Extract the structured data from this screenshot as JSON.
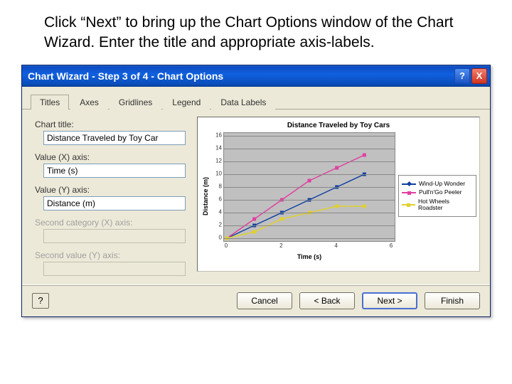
{
  "instruction": "Click “Next” to bring up the Chart Options window of the Chart Wizard.  Enter the title and appropriate axis-labels.",
  "window": {
    "title": "Chart Wizard - Step 3 of 4 - Chart Options"
  },
  "tabs": [
    "Titles",
    "Axes",
    "Gridlines",
    "Legend",
    "Data Labels"
  ],
  "active_tab": "Titles",
  "fields": {
    "chart_title": {
      "label": "Chart title:",
      "value": "Distance Traveled by Toy Car"
    },
    "value_x": {
      "label": "Value (X) axis:",
      "value": "Time (s)"
    },
    "value_y": {
      "label": "Value (Y) axis:",
      "value": "Distance (m)"
    },
    "second_x": {
      "label": "Second category (X) axis:",
      "value": ""
    },
    "second_y": {
      "label": "Second value (Y) axis:",
      "value": ""
    }
  },
  "buttons": {
    "help": "?",
    "cancel": "Cancel",
    "back": "< Back",
    "next": "Next >",
    "finish": "Finish"
  },
  "titlebar_buttons": {
    "help": "?",
    "close": "X"
  },
  "chart_data": {
    "type": "line",
    "title": "Distance Traveled by Toy Cars",
    "xlabel": "Time (s)",
    "ylabel": "Distance (m)",
    "x": [
      0,
      1,
      2,
      3,
      4,
      5
    ],
    "xticks": [
      0,
      2,
      4,
      6
    ],
    "yticks": [
      0,
      2,
      4,
      6,
      8,
      10,
      12,
      14,
      16
    ],
    "ylim": [
      0,
      16
    ],
    "xlim": [
      0,
      6
    ],
    "series": [
      {
        "name": "Wind-Up Wonder",
        "color": "#1040a0",
        "values": [
          0,
          2,
          4,
          6,
          8,
          10
        ]
      },
      {
        "name": "Pull'n'Go Peeler",
        "color": "#e040a0",
        "values": [
          0,
          3,
          6,
          9,
          11,
          13
        ]
      },
      {
        "name": "Hot Wheels Roadster",
        "color": "#e0d030",
        "values": [
          0,
          1,
          3,
          4,
          5,
          5
        ]
      }
    ],
    "legend_position": "right",
    "grid": true
  }
}
